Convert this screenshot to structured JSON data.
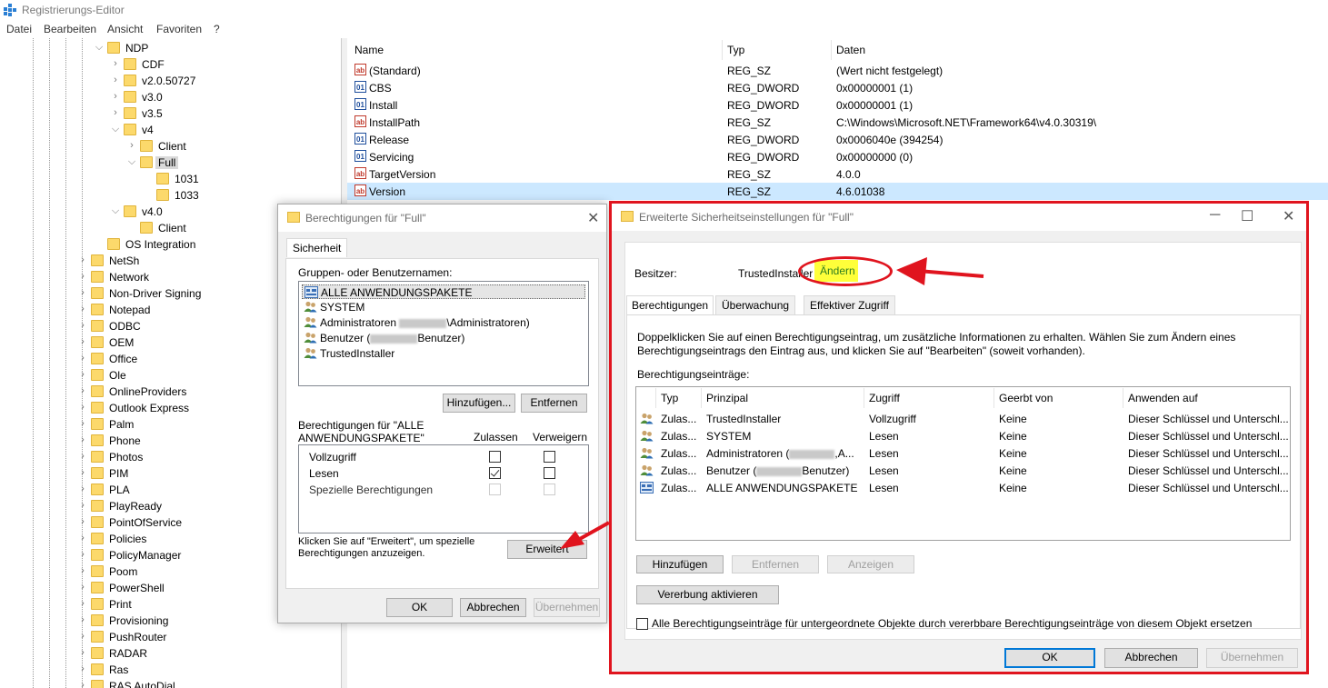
{
  "app": {
    "title": "Registrierungs-Editor"
  },
  "menu": [
    "Datei",
    "Bearbeiten",
    "Ansicht",
    "Favoriten",
    "?"
  ],
  "tree": [
    {
      "label": "NDP",
      "depth": 0
    },
    {
      "label": "CDF",
      "depth": 1
    },
    {
      "label": "v2.0.50727",
      "depth": 1
    },
    {
      "label": "v3.0",
      "depth": 1
    },
    {
      "label": "v3.5",
      "depth": 1
    },
    {
      "label": "v4",
      "depth": 1
    },
    {
      "label": "Client",
      "depth": 2
    },
    {
      "label": "Full",
      "depth": 2,
      "selected": true
    },
    {
      "label": "1031",
      "depth": 3
    },
    {
      "label": "1033",
      "depth": 3
    },
    {
      "label": "v4.0",
      "depth": 1
    },
    {
      "label": "Client",
      "depth": 2
    },
    {
      "label": "OS Integration",
      "depth": 0
    },
    {
      "label": "NetSh",
      "depth": -1
    },
    {
      "label": "Network",
      "depth": -1
    },
    {
      "label": "Non-Driver Signing",
      "depth": -1
    },
    {
      "label": "Notepad",
      "depth": -1
    },
    {
      "label": "ODBC",
      "depth": -1
    },
    {
      "label": "OEM",
      "depth": -1
    },
    {
      "label": "Office",
      "depth": -1
    },
    {
      "label": "Ole",
      "depth": -1
    },
    {
      "label": "OnlineProviders",
      "depth": -1
    },
    {
      "label": "Outlook Express",
      "depth": -1
    },
    {
      "label": "Palm",
      "depth": -1
    },
    {
      "label": "Phone",
      "depth": -1
    },
    {
      "label": "Photos",
      "depth": -1
    },
    {
      "label": "PIM",
      "depth": -1
    },
    {
      "label": "PLA",
      "depth": -1
    },
    {
      "label": "PlayReady",
      "depth": -1
    },
    {
      "label": "PointOfService",
      "depth": -1
    },
    {
      "label": "Policies",
      "depth": -1
    },
    {
      "label": "PolicyManager",
      "depth": -1
    },
    {
      "label": "Poom",
      "depth": -1
    },
    {
      "label": "PowerShell",
      "depth": -1
    },
    {
      "label": "Print",
      "depth": -1
    },
    {
      "label": "Provisioning",
      "depth": -1
    },
    {
      "label": "PushRouter",
      "depth": -1
    },
    {
      "label": "RADAR",
      "depth": -1
    },
    {
      "label": "Ras",
      "depth": -1
    },
    {
      "label": "RAS AutoDial",
      "depth": -1
    }
  ],
  "list": {
    "headers": {
      "name": "Name",
      "type": "Typ",
      "data": "Daten"
    },
    "rows": [
      {
        "name": "(Standard)",
        "type": "REG_SZ",
        "data": "(Wert nicht festgelegt)",
        "icon": "ab"
      },
      {
        "name": "CBS",
        "type": "REG_DWORD",
        "data": "0x00000001 (1)",
        "icon": "dw"
      },
      {
        "name": "Install",
        "type": "REG_DWORD",
        "data": "0x00000001 (1)",
        "icon": "dw"
      },
      {
        "name": "InstallPath",
        "type": "REG_SZ",
        "data": "C:\\Windows\\Microsoft.NET\\Framework64\\v4.0.30319\\",
        "icon": "ab"
      },
      {
        "name": "Release",
        "type": "REG_DWORD",
        "data": "0x0006040e (394254)",
        "icon": "dw"
      },
      {
        "name": "Servicing",
        "type": "REG_DWORD",
        "data": "0x00000000 (0)",
        "icon": "dw"
      },
      {
        "name": "TargetVersion",
        "type": "REG_SZ",
        "data": "4.0.0",
        "icon": "ab"
      },
      {
        "name": "Version",
        "type": "REG_SZ",
        "data": "4.6.01038",
        "icon": "ab",
        "selected": true
      }
    ]
  },
  "dlg1": {
    "title": "Berechtigungen für \"Full\"",
    "tab": "Sicherheit",
    "group_label": "Gruppen- oder Benutzernamen:",
    "users": [
      {
        "pre": "ALLE ANWENDUNGSPAKETE",
        "post": "",
        "icon": "pkg"
      },
      {
        "pre": "SYSTEM",
        "post": "",
        "icon": "grp"
      },
      {
        "pre": "Administratoren ",
        "post": "\\Administratoren)",
        "icon": "grp"
      },
      {
        "pre": "Benutzer (",
        "post": "Benutzer)",
        "icon": "grp"
      },
      {
        "pre": "TrustedInstaller",
        "post": "",
        "icon": "grp"
      }
    ],
    "add_btn": "Hinzufügen...",
    "remove_btn": "Entfernen",
    "perm_label": "Berechtigungen für \"ALLE ANWENDUNGSPAKETE\"",
    "allow_header": "Zulassen",
    "deny_header": "Verweigern",
    "perms": [
      {
        "label": "Vollzugriff",
        "allow": false,
        "deny": false
      },
      {
        "label": "Lesen",
        "allow": true,
        "deny": false
      },
      {
        "label": "Spezielle Berechtigungen",
        "allow": false,
        "deny": false,
        "disabled": true
      }
    ],
    "advanced_hint": "Klicken Sie auf \"Erweitert\", um spezielle Berechtigungen anzuzeigen.",
    "advanced_btn": "Erweitert",
    "ok": "OK",
    "cancel": "Abbrechen",
    "apply": "Übernehmen"
  },
  "dlg2": {
    "title": "Erweiterte Sicherheitseinstellungen für \"Full\"",
    "owner_label": "Besitzer:",
    "owner_value": "TrustedInstaller",
    "change_link": "Ändern",
    "tabs": [
      "Berechtigungen",
      "Überwachung",
      "Effektiver Zugriff"
    ],
    "info": "Doppelklicken Sie auf einen Berechtigungseintrag, um zusätzliche Informationen zu erhalten. Wählen Sie zum Ändern eines Berechtigungseintrags den Eintrag aus, und klicken Sie auf \"Bearbeiten\" (soweit vorhanden).",
    "entries_label": "Berechtigungseinträge:",
    "columns": [
      "Typ",
      "Prinzipal",
      "Zugriff",
      "Geerbt von",
      "Anwenden auf"
    ],
    "entries": [
      {
        "type": "Zulas...",
        "principal": "TrustedInstaller",
        "blur": false,
        "access": "Vollzugriff",
        "inherited": "Keine",
        "applies": "Dieser Schlüssel und Unterschl...",
        "icon": "grp"
      },
      {
        "type": "Zulas...",
        "principal": "SYSTEM",
        "blur": false,
        "access": "Lesen",
        "inherited": "Keine",
        "applies": "Dieser Schlüssel und Unterschl...",
        "icon": "grp"
      },
      {
        "type": "Zulas...",
        "principal": "Administratoren (",
        "principal_post": ",A...",
        "blur": true,
        "access": "Lesen",
        "inherited": "Keine",
        "applies": "Dieser Schlüssel und Unterschl...",
        "icon": "grp"
      },
      {
        "type": "Zulas...",
        "principal": "Benutzer (",
        "principal_post": "Benutzer)",
        "blur": true,
        "access": "Lesen",
        "inherited": "Keine",
        "applies": "Dieser Schlüssel und Unterschl...",
        "icon": "grp"
      },
      {
        "type": "Zulas...",
        "principal": "ALLE ANWENDUNGSPAKETE",
        "blur": false,
        "access": "Lesen",
        "inherited": "Keine",
        "applies": "Dieser Schlüssel und Unterschl...",
        "icon": "pkg"
      }
    ],
    "add_btn": "Hinzufügen",
    "remove_btn": "Entfernen",
    "view_btn": "Anzeigen",
    "inherit_btn": "Vererbung aktivieren",
    "replace_label": "Alle Berechtigungseinträge für untergeordnete Objekte durch vererbbare Berechtigungseinträge von diesem Objekt ersetzen",
    "ok": "OK",
    "cancel": "Abbrechen",
    "apply": "Übernehmen"
  },
  "colors": {
    "annotation": "#e0141e",
    "highlight": "#ffff3a",
    "selection": "#cce8ff",
    "folder": "#fcd96b"
  }
}
